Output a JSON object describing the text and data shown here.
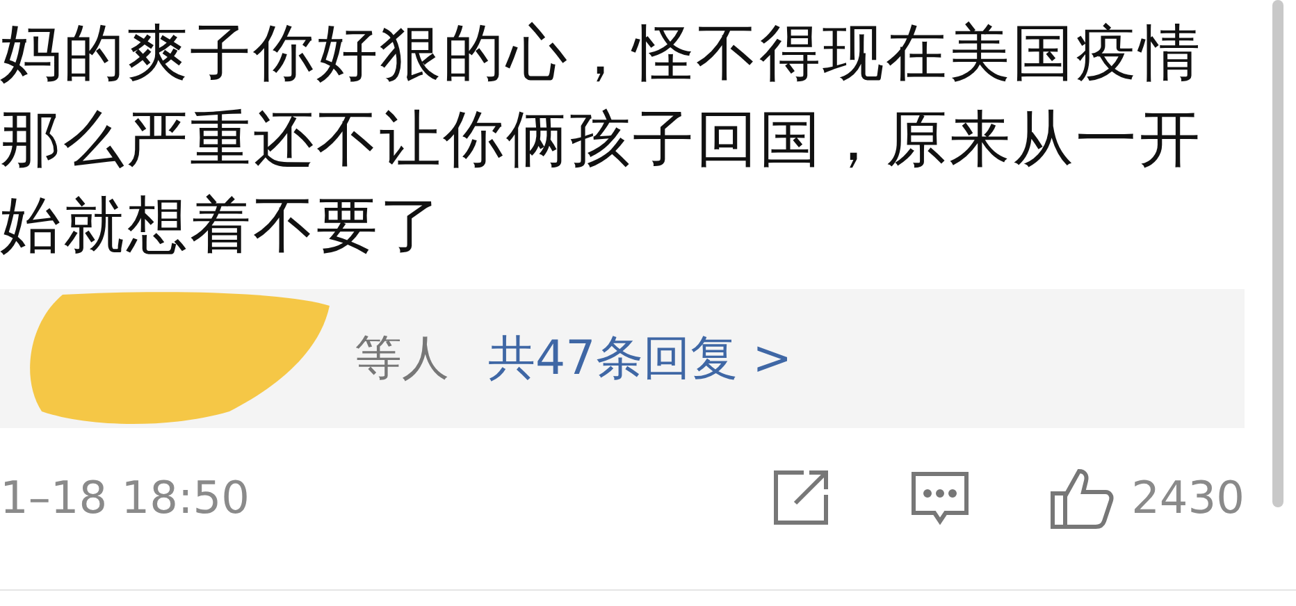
{
  "comment": {
    "text": "妈的爽子你好狠的心，怪不得现在美国疫情那么严重还不让你俩孩子回国，原来从一开始就想着不要了"
  },
  "replies": {
    "suffix": "等人",
    "link": "共47条回复 >"
  },
  "footer": {
    "time": "1–18 18:50",
    "likes": "2430"
  }
}
